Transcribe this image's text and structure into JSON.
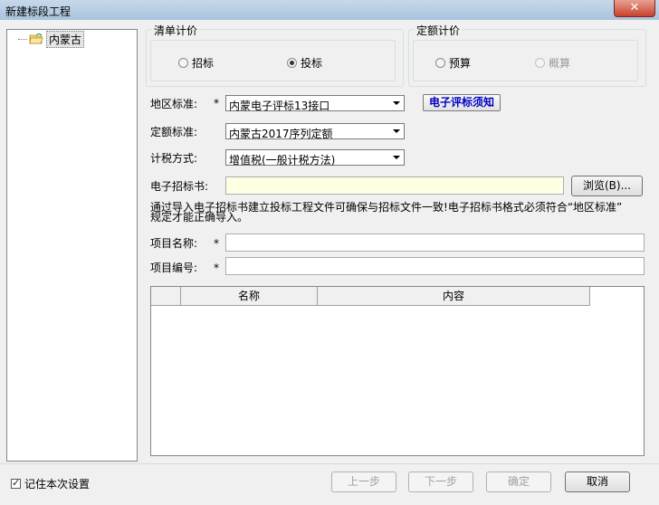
{
  "window": {
    "title": "新建标段工程",
    "close": "✕"
  },
  "tree": {
    "node_label": "内蒙古"
  },
  "list_pricing": {
    "legend": "清单计价",
    "option1": "招标",
    "option2": "投标",
    "selected": "投标"
  },
  "quota_pricing": {
    "legend": "定额计价",
    "option1": "预算",
    "option2": "概算",
    "selected": "预算"
  },
  "form": {
    "region_label": "地区标准:",
    "region_value": "内蒙电子评标13接口",
    "notice_button": "电子评标须知",
    "quota_label": "定额标准:",
    "quota_value": "内蒙古2017序列定额",
    "tax_label": "计税方式:",
    "tax_value": "增值税(一般计税方法)",
    "tender_label": "电子招标书:",
    "tender_value": "",
    "browse_button": "浏览(B)...",
    "note_line1": "通过导入电子招标书建立投标工程文件可确保与招标文件一致!电子招标书格式必须符合“地区标准”",
    "note_line2": "规定才能正确导入。",
    "name_label": "项目名称:",
    "name_value": "",
    "number_label": "项目编号:",
    "number_value": "",
    "required": "*"
  },
  "grid": {
    "columns": [
      "名称",
      "内容"
    ]
  },
  "footer": {
    "remember": "记住本次设置",
    "remember_checked": true,
    "prev": "上一步",
    "next": "下一步",
    "ok": "确定",
    "cancel": "取消"
  }
}
